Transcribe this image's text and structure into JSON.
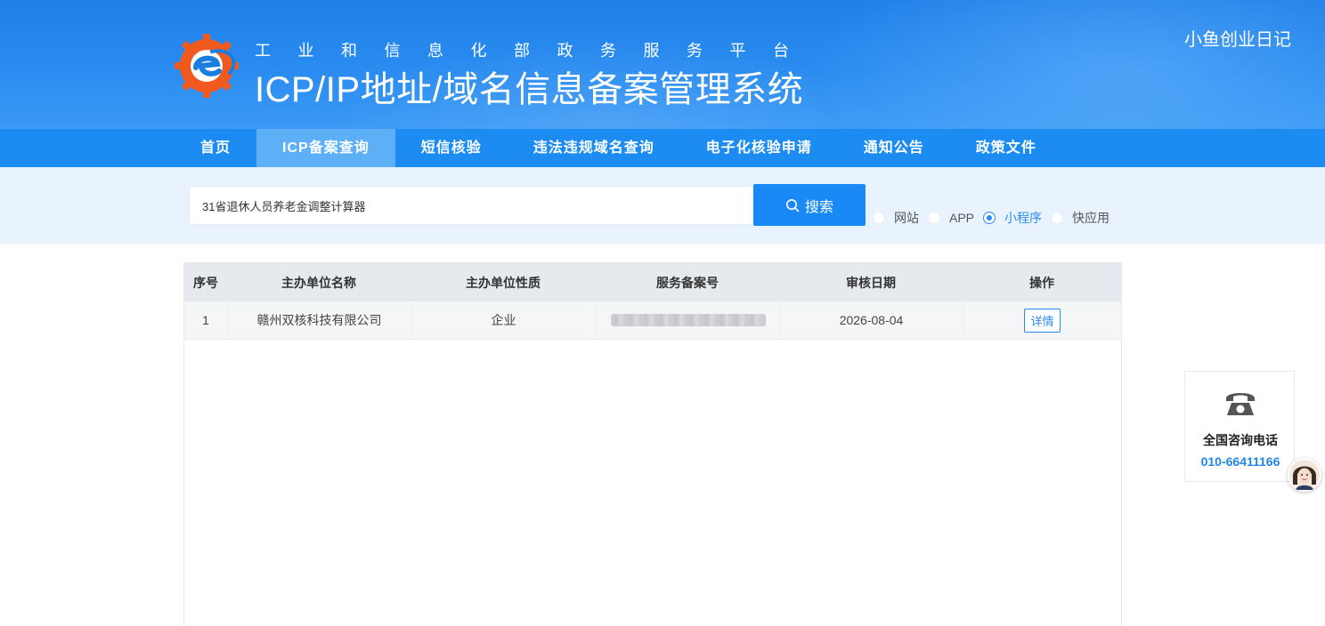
{
  "header": {
    "subtitle": "工业和信息化部政务服务平台",
    "title": "ICP/IP地址/域名信息备案管理系统",
    "watermark": "小鱼创业日记"
  },
  "nav": {
    "items": [
      {
        "label": "首页",
        "active": false
      },
      {
        "label": "ICP备案查询",
        "active": true
      },
      {
        "label": "短信核验",
        "active": false
      },
      {
        "label": "违法违规域名查询",
        "active": false
      },
      {
        "label": "电子化核验申请",
        "active": false
      },
      {
        "label": "通知公告",
        "active": false
      },
      {
        "label": "政策文件",
        "active": false
      }
    ]
  },
  "search": {
    "value": "31省退休人员养老金调整计算器",
    "button_label": "搜索",
    "types": [
      {
        "label": "网站",
        "checked": false
      },
      {
        "label": "APP",
        "checked": false
      },
      {
        "label": "小程序",
        "checked": true
      },
      {
        "label": "快应用",
        "checked": false
      }
    ]
  },
  "table": {
    "headers": [
      "序号",
      "主办单位名称",
      "主办单位性质",
      "服务备案号",
      "审核日期",
      "操作"
    ],
    "rows": [
      {
        "index": "1",
        "org": "赣州双核科技有限公司",
        "nature": "企业",
        "record_no": "",
        "date": "2026-08-04",
        "action": "详情"
      }
    ]
  },
  "contact": {
    "label": "全国咨询电话",
    "phone": "010-66411166"
  },
  "colors": {
    "brand_blue": "#1d8cf2",
    "nav_active": "#5db0f6",
    "link_blue": "#2b8cf0",
    "logo_orange": "#f05a1e"
  }
}
